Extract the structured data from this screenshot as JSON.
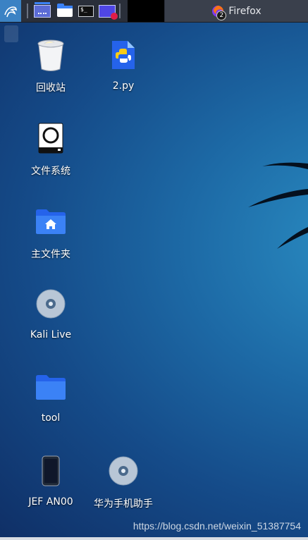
{
  "taskbar": {
    "active_window_title": "Firefox",
    "window_count_badge": "2",
    "launchers": [
      "kali-menu-icon",
      "desktop-icon",
      "file-manager-icon",
      "terminal-icon",
      "screen-recorder-icon"
    ]
  },
  "desktop": {
    "icons": [
      {
        "label": "回收站",
        "icon": "trash-icon"
      },
      {
        "label": "2.py",
        "icon": "python-file-icon"
      },
      {
        "label": "文件系统",
        "icon": "filesystem-drive-icon"
      },
      {
        "label": "主文件夹",
        "icon": "home-folder-icon"
      },
      {
        "label": "Kali Live",
        "icon": "optical-disc-icon"
      },
      {
        "label": "tool",
        "icon": "folder-icon"
      },
      {
        "label": "JEF AN00",
        "icon": "phone-icon"
      },
      {
        "label": "华为手机助手",
        "icon": "optical-disc-icon"
      }
    ]
  },
  "watermark": "https://blog.csdn.net/weixin_51387754",
  "colors": {
    "desktop_dark": "#0f2f66",
    "desktop_light": "#2b8fc4",
    "taskbar": "#2a2f3a",
    "folder_blue": "#3b82f6"
  }
}
